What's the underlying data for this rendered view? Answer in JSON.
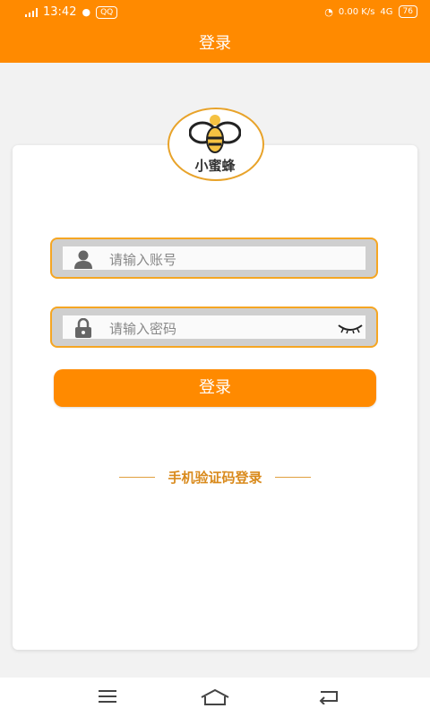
{
  "status_bar": {
    "network": "4G",
    "time": "13:42",
    "badge": "QQ",
    "speed": "0.00 K/s",
    "net_right": "4G",
    "battery": "76"
  },
  "header": {
    "title": "登录"
  },
  "logo": {
    "name": "小蜜蜂"
  },
  "form": {
    "account_placeholder": "请输入账号",
    "password_placeholder": "请输入密码",
    "login_label": "登录"
  },
  "sms_login_label": "手机验证码登录",
  "colors": {
    "accent": "#ff8a00",
    "border": "#f5a623",
    "sms_text": "#d98a1c"
  },
  "icons": {
    "user": "user-icon",
    "lock": "lock-icon",
    "eye": "eye-closed-icon",
    "menu": "menu-icon",
    "home": "home-icon",
    "back": "back-icon"
  }
}
